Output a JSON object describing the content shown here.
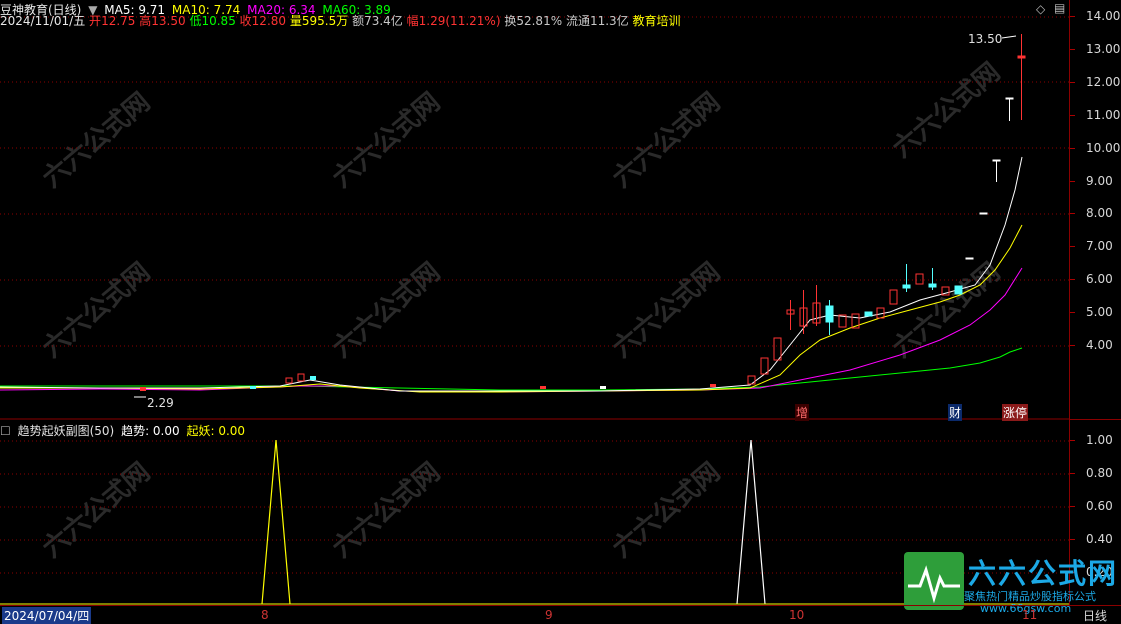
{
  "header": {
    "title": "豆神教育(日线)",
    "ma5": "MA5: 9.71",
    "ma10": "MA10: 7.74",
    "ma20": "MA20: 6.34",
    "ma60": "MA60: 3.89",
    "date": "2024/11/01/五",
    "open_label": "开",
    "open": "12.75",
    "high_label": "高",
    "high": "13.50",
    "low_label": "低",
    "low": "10.85",
    "close_label": "收",
    "close": "12.80",
    "vol_label": "量",
    "vol": "595.5万",
    "amount_label": "额",
    "amount": "73.4亿",
    "chg_label": "幅",
    "chg": "1.29(11.21%)",
    "turnover_label": "换",
    "turnover": "52.81%",
    "float_label": "流通",
    "float": "11.3亿",
    "sector": "教育培训"
  },
  "indicator": {
    "name": "趋势起妖副图(50)",
    "trend": "趋势: 0.00",
    "yao": "起妖: 0.00"
  },
  "price_axis": [
    "14.00",
    "13.00",
    "12.00",
    "11.00",
    "10.00",
    "9.00",
    "8.00",
    "7.00",
    "6.00",
    "5.00",
    "4.00"
  ],
  "indicator_axis": [
    "1.00",
    "0.80",
    "0.60",
    "0.40",
    "0.20"
  ],
  "annotations": {
    "high_mark": "13.50",
    "low_mark": "2.29",
    "tag_zeng": "增",
    "tag_cai": "财",
    "tag_zhangting": "涨停"
  },
  "date_axis": {
    "first": "2024/07/04/四",
    "m8": "8",
    "m9": "9",
    "m10": "10",
    "m11": "11",
    "period": "日线"
  },
  "watermark": {
    "brand": "六六公式网",
    "slogan": "聚焦热门精品炒股指标公式",
    "url": "www.66gsw.com",
    "tile": "六六公式网"
  },
  "colors": {
    "up": "#ff3333",
    "down": "#54ffff",
    "ma5": "#ffffff",
    "ma10": "#ffff00",
    "ma20": "#ff00ff",
    "ma60": "#00ff00",
    "grid": "#8b0000"
  }
}
